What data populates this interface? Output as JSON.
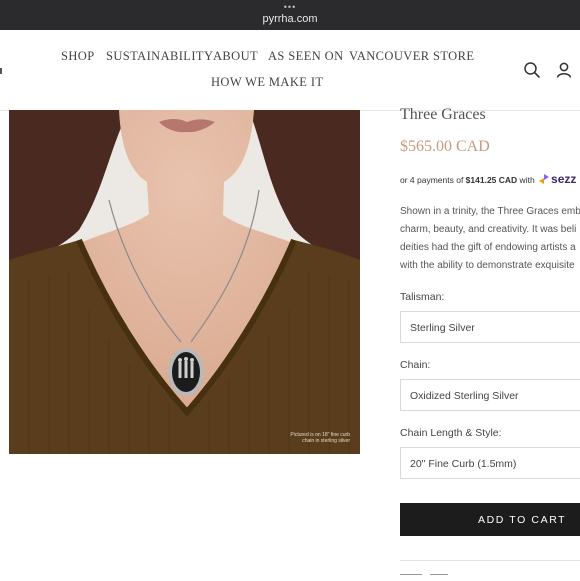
{
  "browser": {
    "dots": "•••",
    "url": "pyrrha.com"
  },
  "nav": {
    "items": [
      "SHOP",
      "SUSTAINABILITY",
      "ABOUT",
      "AS SEEN ON",
      "VANCOUVER STORE",
      "HOW WE MAKE IT"
    ],
    "icons": [
      "search-icon",
      "account-icon"
    ]
  },
  "image": {
    "caption": "Pictured is on 18\" fine curb\nchain in sterling silver"
  },
  "product": {
    "title": "Three Graces",
    "price": "$565.00 CAD",
    "installments": {
      "prefix": "or 4 payments of ",
      "amount": "$141.25 CAD",
      "with": " with ",
      "brand": "sezz"
    },
    "description_lines": [
      "Shown in a trinity, the Three Graces emb",
      "charm, beauty, and creativity. It was beli",
      "deities had the gift of endowing artists a",
      "with the ability to demonstrate exquisite"
    ]
  },
  "options": {
    "talisman": {
      "label": "Talisman:",
      "value": "Sterling Silver"
    },
    "chain": {
      "label": "Chain:",
      "value": "Oxidized Sterling Silver"
    },
    "length": {
      "label": "Chain Length & Style:",
      "value": "20\" Fine Curb (1.5mm)"
    }
  },
  "cart": {
    "label": "ADD TO CART"
  },
  "colors": {
    "price": "#c99a7f",
    "button": "#1c1c1c",
    "sweater": "#5a3d1c",
    "brand": "#3d2b6b"
  }
}
